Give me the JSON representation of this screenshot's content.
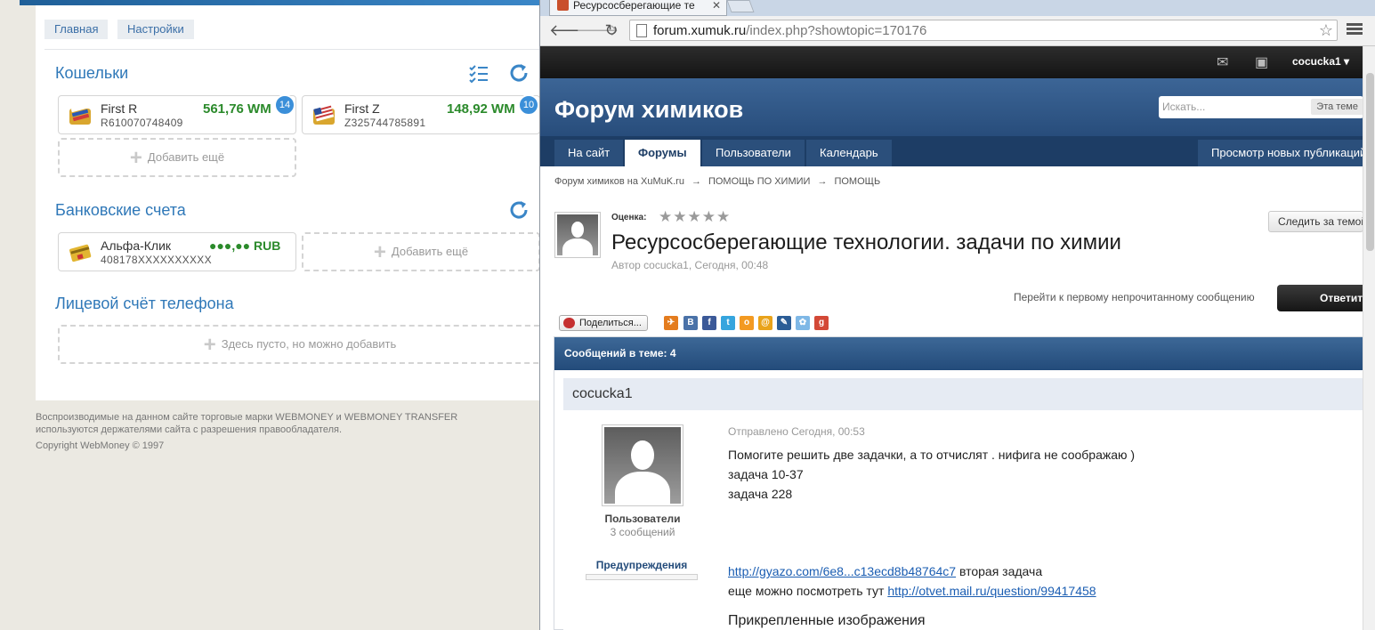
{
  "webmoney": {
    "nav": {
      "home": "Главная",
      "settings": "Настройки"
    },
    "wallets": {
      "title": "Кошельки",
      "items": [
        {
          "name": "First R",
          "number": "R610070748409",
          "balance": "561,76 WM",
          "badge": "14"
        },
        {
          "name": "First Z",
          "number": "Z325744785891",
          "balance": "148,92 WM",
          "badge": "10"
        }
      ],
      "add_label": "Добавить ещё"
    },
    "bank": {
      "title": "Банковские счета",
      "items": [
        {
          "name": "Альфа-Клик",
          "number": "408178XXXXXXXXXX",
          "balance": "●●●,●● RUB"
        }
      ],
      "add_label": "Добавить ещё"
    },
    "phone": {
      "title": "Лицевой счёт телефона",
      "empty_label": "Здесь пусто, но можно добавить"
    },
    "footer": {
      "line1": "Воспроизводимые на данном сайте торговые марки WEBMONEY и WEBMONEY TRANSFER",
      "line2": "используются держателями сайта с разрешения правообладателя.",
      "line3": "Copyright WebMoney © 1997"
    }
  },
  "browser": {
    "tab_title": "Ресурсосберегающие те",
    "url_host": "forum.xumuk.ru",
    "url_path": "/index.php?showtopic=170176"
  },
  "forum": {
    "username": "cocucka1",
    "logo": "Форум химиков",
    "search_placeholder": "Искать...",
    "search_scope": "Эта теме",
    "nav": [
      "На сайт",
      "Форумы",
      "Пользователи",
      "Календарь"
    ],
    "nav_right": "Просмотр новых публикаций",
    "breadcrumb": [
      "Форум химиков на XuMuK.ru",
      "ПОМОЩЬ ПО ХИМИИ",
      "ПОМОЩЬ"
    ],
    "rating_label": "Оценка:",
    "rating_stars": "★★★★★",
    "topic_title": "Ресурсосберегающие технологии. задачи по химии",
    "topic_author": "Автор cocucka1, Сегодня, 00:48",
    "follow": "Следить за темой",
    "first_unread": "Перейти к первому непрочитанному сообщению",
    "reply": "Ответить",
    "share": "Поделиться...",
    "posts_count": "Сообщений в теме: 4",
    "post": {
      "author": "cocucka1",
      "group": "Пользователи",
      "count": "3 сообщений",
      "warnings": "Предупреждения",
      "date": "Отправлено Сегодня, 00:53",
      "lines": [
        "Помогите решить две задачки, а то отчислят . нифига не соображаю )",
        "задача 10-37",
        "задача 228"
      ],
      "link1": "http://gyazo.com/6e8...c13ecd8b48764c7",
      "link1_tail": " вторая задача",
      "line_more": "еще можно посмотреть тут ",
      "link2": "http://otvet.mail.ru/question/99417458",
      "attachments": "Прикрепленные изображения"
    },
    "social_icons": [
      "vk-icon",
      "facebook-icon",
      "twitter-icon",
      "odnoklassniki-icon",
      "mailru-icon",
      "livejournal-icon",
      "liveinternet-icon",
      "google-plus-icon"
    ]
  }
}
